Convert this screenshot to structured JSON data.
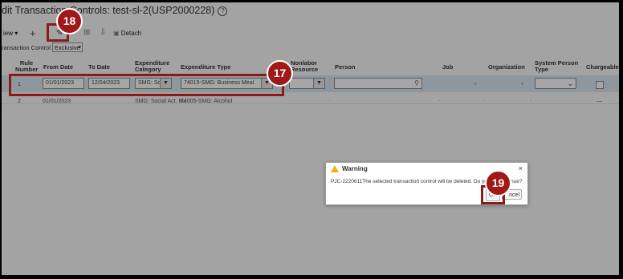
{
  "page": {
    "title": "dit Transaction Controls: test-sl-2(USP2000228)",
    "help_icon": "?"
  },
  "toolbar": {
    "view_label": "iew ▾",
    "add_glyph": "+",
    "edit_glyph": "✎",
    "icon1_glyph": "⊞",
    "icon2_glyph": "⇩",
    "detach_label": "Detach"
  },
  "transaction_control": {
    "label": "ransaction Control",
    "value": "Exclusive"
  },
  "table": {
    "headers": {
      "rule_number": [
        "Rule",
        "Number"
      ],
      "from_date": "From Date",
      "to_date": "To Date",
      "expenditure_category": [
        "Expenditure",
        "Category"
      ],
      "expenditure_type": "Expenditure Type",
      "nonlabor_resource": [
        "Nonlabor",
        "Resource"
      ],
      "person": "Person",
      "job": "Job",
      "organization": "Organization",
      "system_person_type": [
        "System Person",
        "Type"
      ],
      "chargeable": "Chargeable"
    },
    "rows": [
      {
        "rule_number": "1",
        "from_date": "01/01/2023",
        "to_date": "12/04/2023",
        "expenditure_category": "SMG: Soc",
        "expenditure_type": "74015-SMG: Business Meal"
      },
      {
        "rule_number": "2",
        "from_date": "01/01/2023",
        "expenditure_category": "SMG: Social Act. Bu",
        "expenditure_type": "74005-SMG: Alcohol",
        "person": ".",
        "job": ".",
        "organization": ".",
        "system_person_type": ".",
        "chargeable": "—"
      }
    ]
  },
  "dialog": {
    "title": "Warning",
    "message": "PJC-2220611The selected transaction control will be deleted. Do yo",
    "message_tail": "nue?",
    "ok_label": "OK",
    "cancel_label": "ncel",
    "close_glyph": "×"
  },
  "callouts": {
    "step_17": "17",
    "step_18": "18",
    "step_19": "19"
  },
  "colors": {
    "callout": "#8b1a1a",
    "badge": "#a01818",
    "selected_row": "#dce8f3"
  }
}
